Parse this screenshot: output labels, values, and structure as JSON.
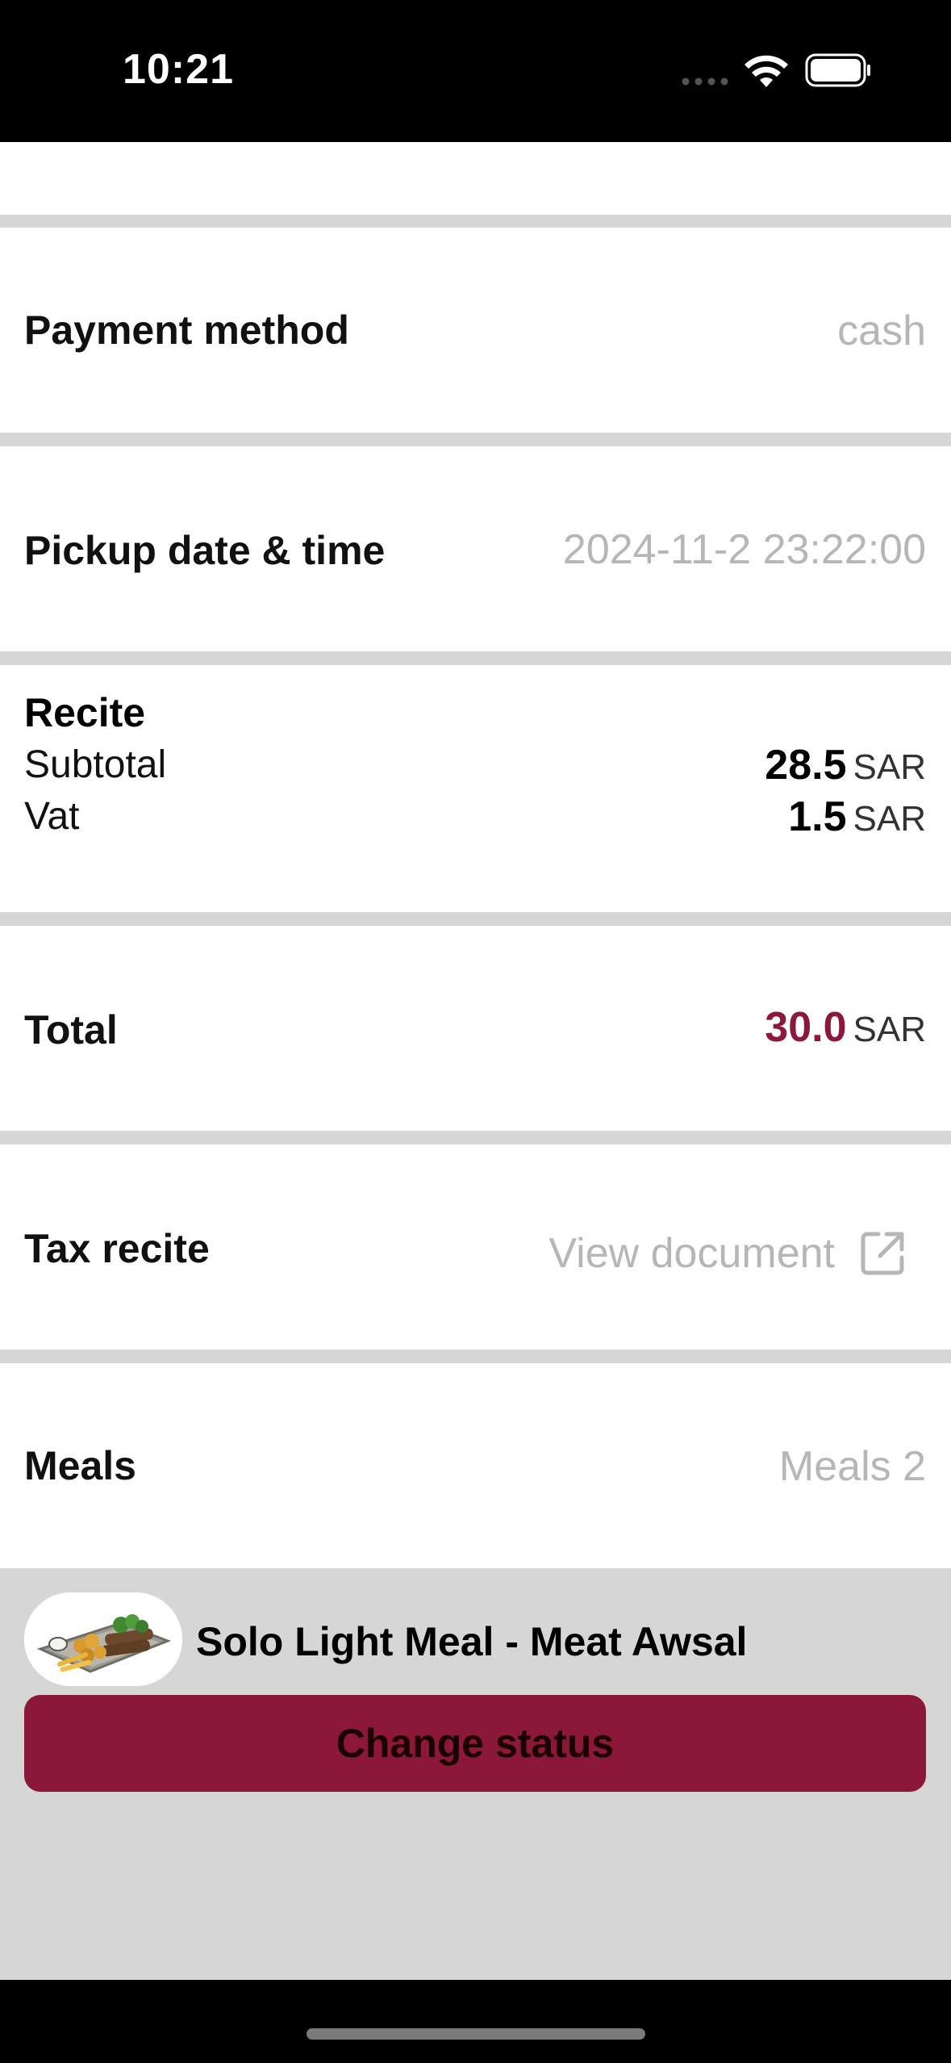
{
  "status_bar": {
    "time": "10:21"
  },
  "rows": {
    "payment": {
      "label": "Payment method",
      "value": "cash"
    },
    "pickup": {
      "label": "Pickup date & time",
      "value": "2024-11-2 23:22:00"
    },
    "receipt": {
      "title": "Recite",
      "subtotal": {
        "label": "Subtotal",
        "value": "28.5",
        "currency": "SAR"
      },
      "vat": {
        "label": "Vat",
        "value": "1.5",
        "currency": "SAR"
      }
    },
    "total": {
      "label": "Total",
      "value": "30.0",
      "currency": "SAR"
    },
    "tax": {
      "label": "Tax recite",
      "link_label": "View document"
    },
    "meals": {
      "label": "Meals",
      "value": "Meals 2"
    }
  },
  "meal_item": {
    "name": "Solo Light Meal - Meat Awsal"
  },
  "actions": {
    "change_status": "Change status"
  },
  "colors": {
    "accent": "#8b1838",
    "muted": "#b6b6b6",
    "divider": "#d6d6d6"
  }
}
